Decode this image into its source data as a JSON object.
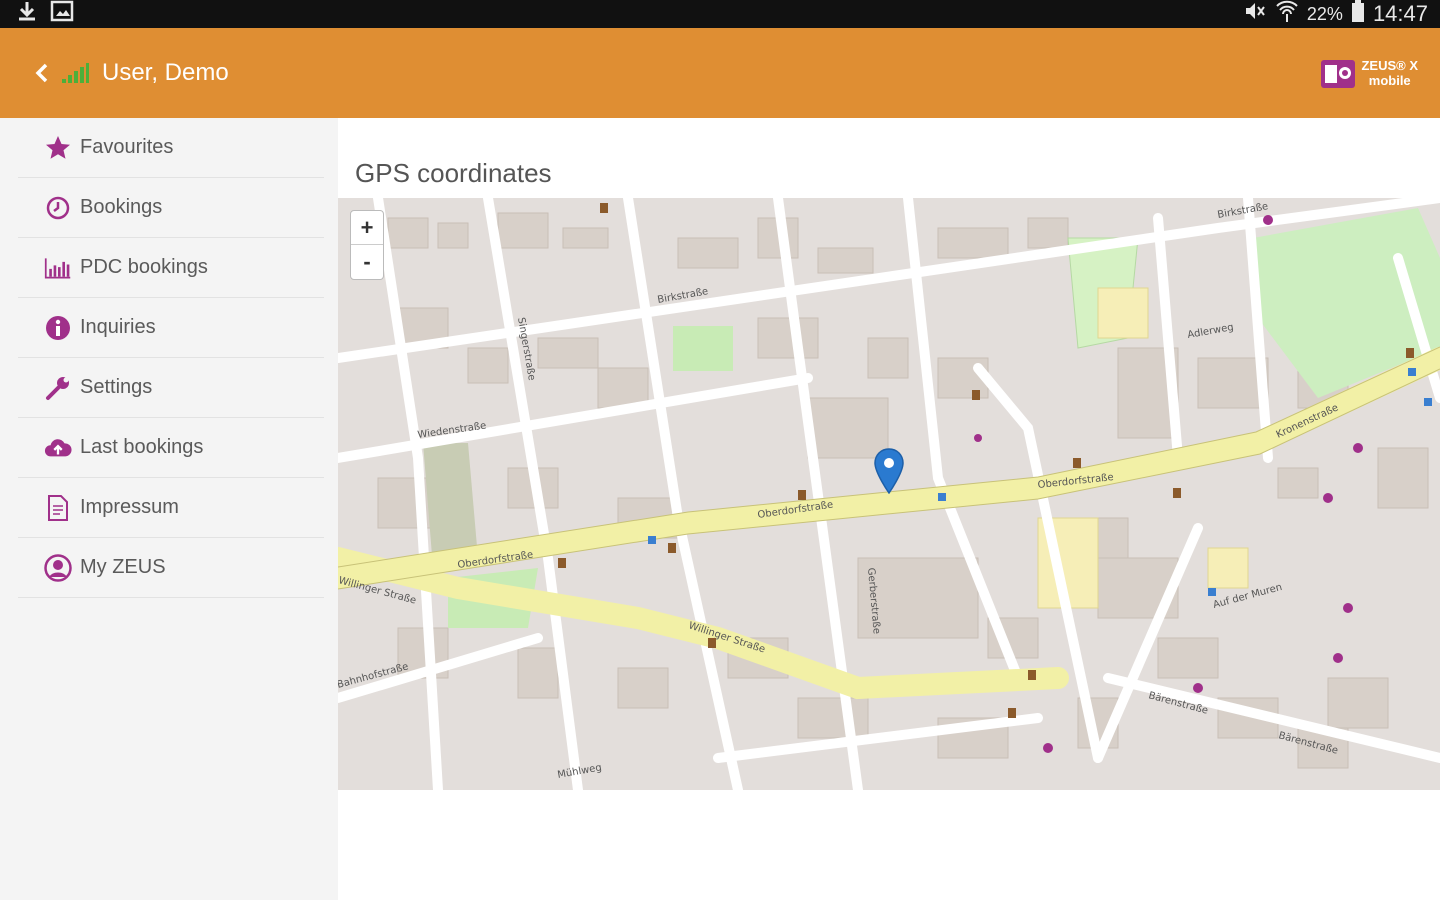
{
  "statusbar": {
    "download_icon": "download-icon",
    "image_icon": "image-icon",
    "mute_icon": "mute-icon",
    "wifi_icon": "wifi-icon",
    "battery_percent": "22%",
    "time": "14:47"
  },
  "appbar": {
    "title": "User, Demo",
    "logo_line1": "ZEUS® X",
    "logo_line2": "mobile",
    "color": "#df8e33"
  },
  "sidebar": {
    "items": [
      {
        "label": "Favourites",
        "icon": "star-icon"
      },
      {
        "label": "Bookings",
        "icon": "clock-icon"
      },
      {
        "label": "PDC bookings",
        "icon": "bar-chart-icon"
      },
      {
        "label": "Inquiries",
        "icon": "info-icon"
      },
      {
        "label": "Settings",
        "icon": "wrench-icon"
      },
      {
        "label": "Last bookings",
        "icon": "cloud-upload-icon"
      },
      {
        "label": "Impressum",
        "icon": "document-icon"
      },
      {
        "label": "My ZEUS",
        "icon": "user-icon"
      }
    ],
    "accent": "#a0308a"
  },
  "main": {
    "title": "GPS coordinates",
    "zoom_in": "+",
    "zoom_out": "-",
    "map_labels": {
      "l1": "Oberdorfstraße",
      "l2": "Willinger Straße",
      "l3": "Kronenstraße",
      "l4": "Bärenstraße",
      "l5": "Wiedenstraße",
      "l6": "Birkstraße",
      "l7": "Auf der Muren",
      "l8": "Mühlweg",
      "l9": "Adlerweg",
      "l10": "Bahnhofstraße",
      "l11": "Singerstraße",
      "l12": "Gerberstraße"
    }
  }
}
